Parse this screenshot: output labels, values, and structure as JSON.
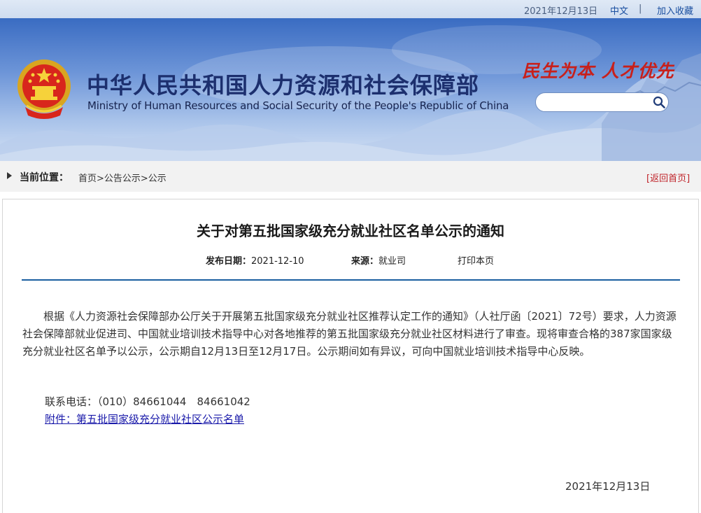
{
  "topbar": {
    "date": "2021年12月13日",
    "lang": "中文",
    "separator": "|",
    "favorite": "加入收藏"
  },
  "header": {
    "title_cn": "中华人民共和国人力资源和社会保障部",
    "title_en": "Ministry of Human Resources and Social Security of the People's Republic of China",
    "slogan": "民生为本 人才优先",
    "search": {
      "value": "",
      "placeholder": ""
    },
    "icons": {
      "emblem": "national-emblem-icon",
      "search": "search-icon"
    },
    "colors": {
      "title": "#1c2f6e",
      "slogan": "#c8201b"
    }
  },
  "breadcrumb": {
    "label": "当前位置：",
    "path": "首页>公告公示>公示",
    "back": "[返回首页]"
  },
  "article": {
    "title": "关于对第五批国家级充分就业社区名单公示的通知",
    "publish_label": "发布日期：",
    "publish_date": "2021-12-10",
    "source_label": "来源：",
    "source": "就业司",
    "print": "打印本页",
    "body": "根据《人力资源社会保障部办公厅关于开展第五批国家级充分就业社区推荐认定工作的通知》（人社厅函〔2021〕72号）要求，人力资源社会保障部就业促进司、中国就业培训技术指导中心对各地推荐的第五批国家级充分就业社区材料进行了审查。现将审查合格的387家国家级充分就业社区名单予以公示，公示期自12月13日至12月17日。公示期间如有异议，可向中国就业培训技术指导中心反映。",
    "contact": "联系电话：（010）84661044　84661042",
    "attachment": "附件：第五批国家级充分就业社区公示名单",
    "sign_date": "2021年12月13日"
  }
}
